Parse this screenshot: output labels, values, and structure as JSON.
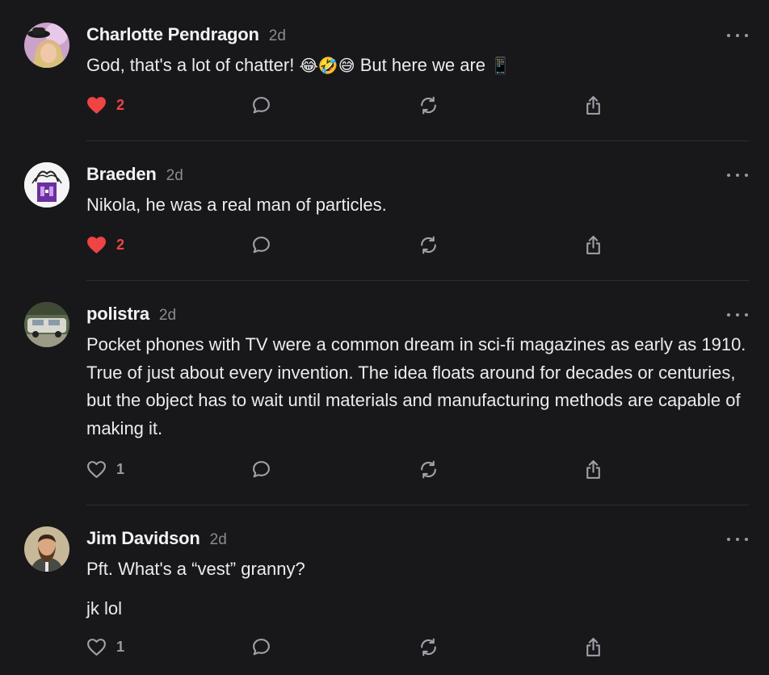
{
  "colors": {
    "background": "#18181b",
    "text": "#ececee",
    "muted": "#8b8b92",
    "like_active": "#ef4444",
    "separator": "#2e2e33"
  },
  "icons": {
    "like_active": "heart-filled-icon",
    "like": "heart-outline-icon",
    "reply": "speech-bubble-icon",
    "restack": "restack-arrows-icon",
    "share": "share-upload-icon",
    "more": "ellipsis-icon"
  },
  "comments": [
    {
      "author": "Charlotte Pendragon",
      "time": "2d",
      "text": "God, that's a lot of chatter!",
      "emoji": "😂🤣😅",
      "text_after": "But here we are",
      "emoji_end": "📱",
      "likes": "2",
      "liked": true
    },
    {
      "author": "Braeden",
      "time": "2d",
      "text": "Nikola, he was a real man of particles.",
      "likes": "2",
      "liked": true
    },
    {
      "author": "polistra",
      "time": "2d",
      "text": "Pocket phones with TV were a common dream in sci-fi magazines as early as 1910. True of just about every invention. The idea floats around for decades or centuries, but the object has to wait until materials and manufacturing methods are capable of making it.",
      "likes": "1",
      "liked": false
    },
    {
      "author": "Jim Davidson",
      "time": "2d",
      "text": "Pft. What's a “vest” granny?",
      "text_2": "jk lol",
      "likes": "1",
      "liked": false
    }
  ]
}
